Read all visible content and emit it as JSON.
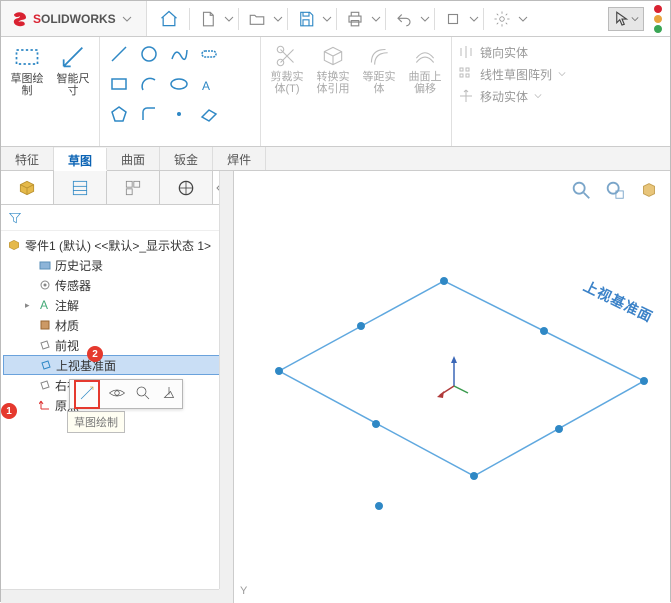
{
  "app": {
    "name": "SOLIDWORKS"
  },
  "ribbon": {
    "sketch_btn": "草图绘\n制",
    "smart_dim": "智能尺\n寸",
    "trim": "剪裁实\n体(T)",
    "convert": "转换实\n体引用",
    "offset_equidist": "等距实\n体",
    "surface_offset": "曲面上\n偏移",
    "mirror": "镜向实体",
    "linear_pattern": "线性草图阵列",
    "move": "移动实体"
  },
  "tabs": {
    "feature": "特征",
    "sketch": "草图",
    "surface": "曲面",
    "sheetmetal": "钣金",
    "weldment": "焊件"
  },
  "tree": {
    "root": "零件1 (默认) <<默认>_显示状态 1>",
    "history": "历史记录",
    "sensors": "传感器",
    "annotations": "注解",
    "material": "材质",
    "front": "前视",
    "top_sel": "上视基准面",
    "right": "右视基准面",
    "origin": "原点"
  },
  "tooltip": "草图绘制",
  "badges": {
    "one": "1",
    "two": "2"
  },
  "viewport": {
    "plane_label": "上视基准面",
    "axis_y": "Y"
  }
}
